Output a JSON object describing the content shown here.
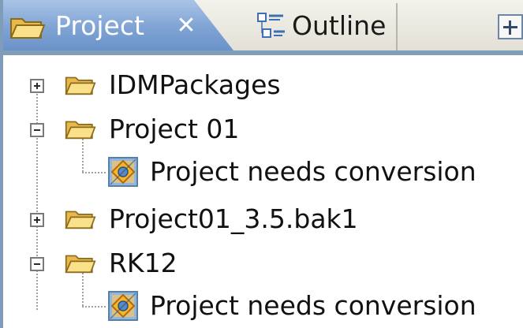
{
  "tabs": [
    {
      "label": "Project",
      "icon": "folder-icon",
      "active": true,
      "close_icon": "close-icon"
    },
    {
      "label": "Outline",
      "icon": "outline-icon",
      "active": false
    }
  ],
  "toolbar": {
    "icon": "expand-all-icon"
  },
  "tree": {
    "nodes": [
      {
        "label": "IDMPackages",
        "icon": "folder-icon",
        "expander": "plus"
      },
      {
        "label": "Project 01",
        "icon": "folder-icon",
        "expander": "minus",
        "children": [
          {
            "label": "Project needs conversion",
            "icon": "warning-icon"
          }
        ]
      },
      {
        "label": "Project01_3.5.bak1",
        "icon": "folder-icon",
        "expander": "plus"
      },
      {
        "label": "RK12",
        "icon": "folder-icon",
        "expander": "minus",
        "children": [
          {
            "label": "Project needs conversion",
            "icon": "warning-icon"
          }
        ]
      }
    ]
  },
  "colors": {
    "active_tab": "#7fa3d4",
    "border": "#7f9db9",
    "folder": "#f2c94c"
  }
}
